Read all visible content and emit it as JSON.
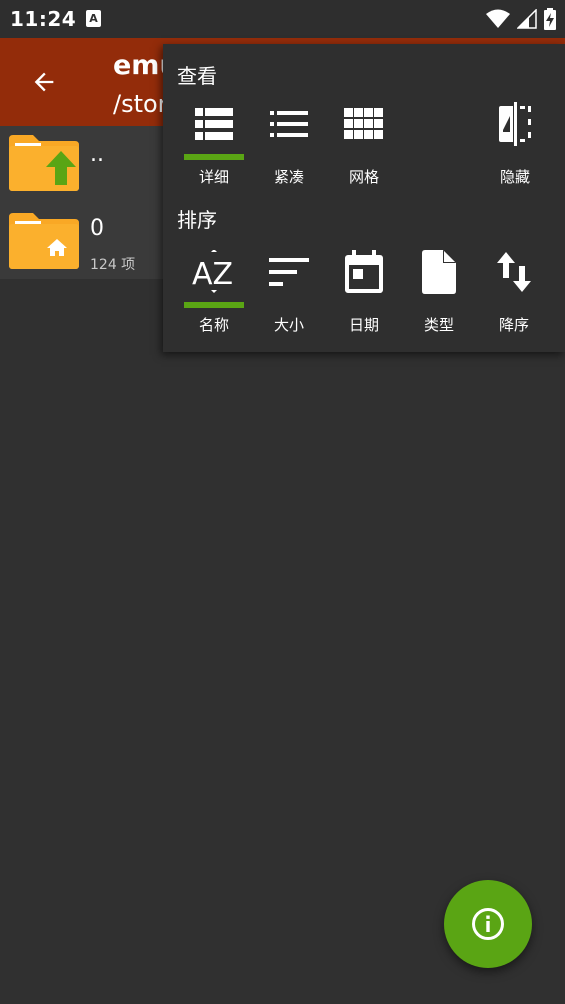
{
  "status_bar": {
    "time": "11:24",
    "notification_letter": "A"
  },
  "app_bar": {
    "title": "emu",
    "path": "/stor"
  },
  "files": [
    {
      "name": "..",
      "meta": ""
    },
    {
      "name": "0",
      "meta": "124 项"
    }
  ],
  "menu": {
    "view": {
      "label": "查看",
      "options": [
        {
          "label": "详细",
          "selected": true
        },
        {
          "label": "紧凑",
          "selected": false
        },
        {
          "label": "网格",
          "selected": false
        },
        {
          "label": "隐藏",
          "selected": false
        }
      ]
    },
    "sort": {
      "label": "排序",
      "options": [
        {
          "label": "名称",
          "selected": true
        },
        {
          "label": "大小",
          "selected": false
        },
        {
          "label": "日期",
          "selected": false
        },
        {
          "label": "类型",
          "selected": false
        },
        {
          "label": "降序",
          "selected": false
        }
      ]
    }
  },
  "colors": {
    "app_bar": "#932c0a",
    "accent": "#5aa514",
    "folder": "#f9a825",
    "background": "#303030"
  },
  "icons": {
    "fab": "info-icon",
    "back": "arrow-back-icon"
  }
}
